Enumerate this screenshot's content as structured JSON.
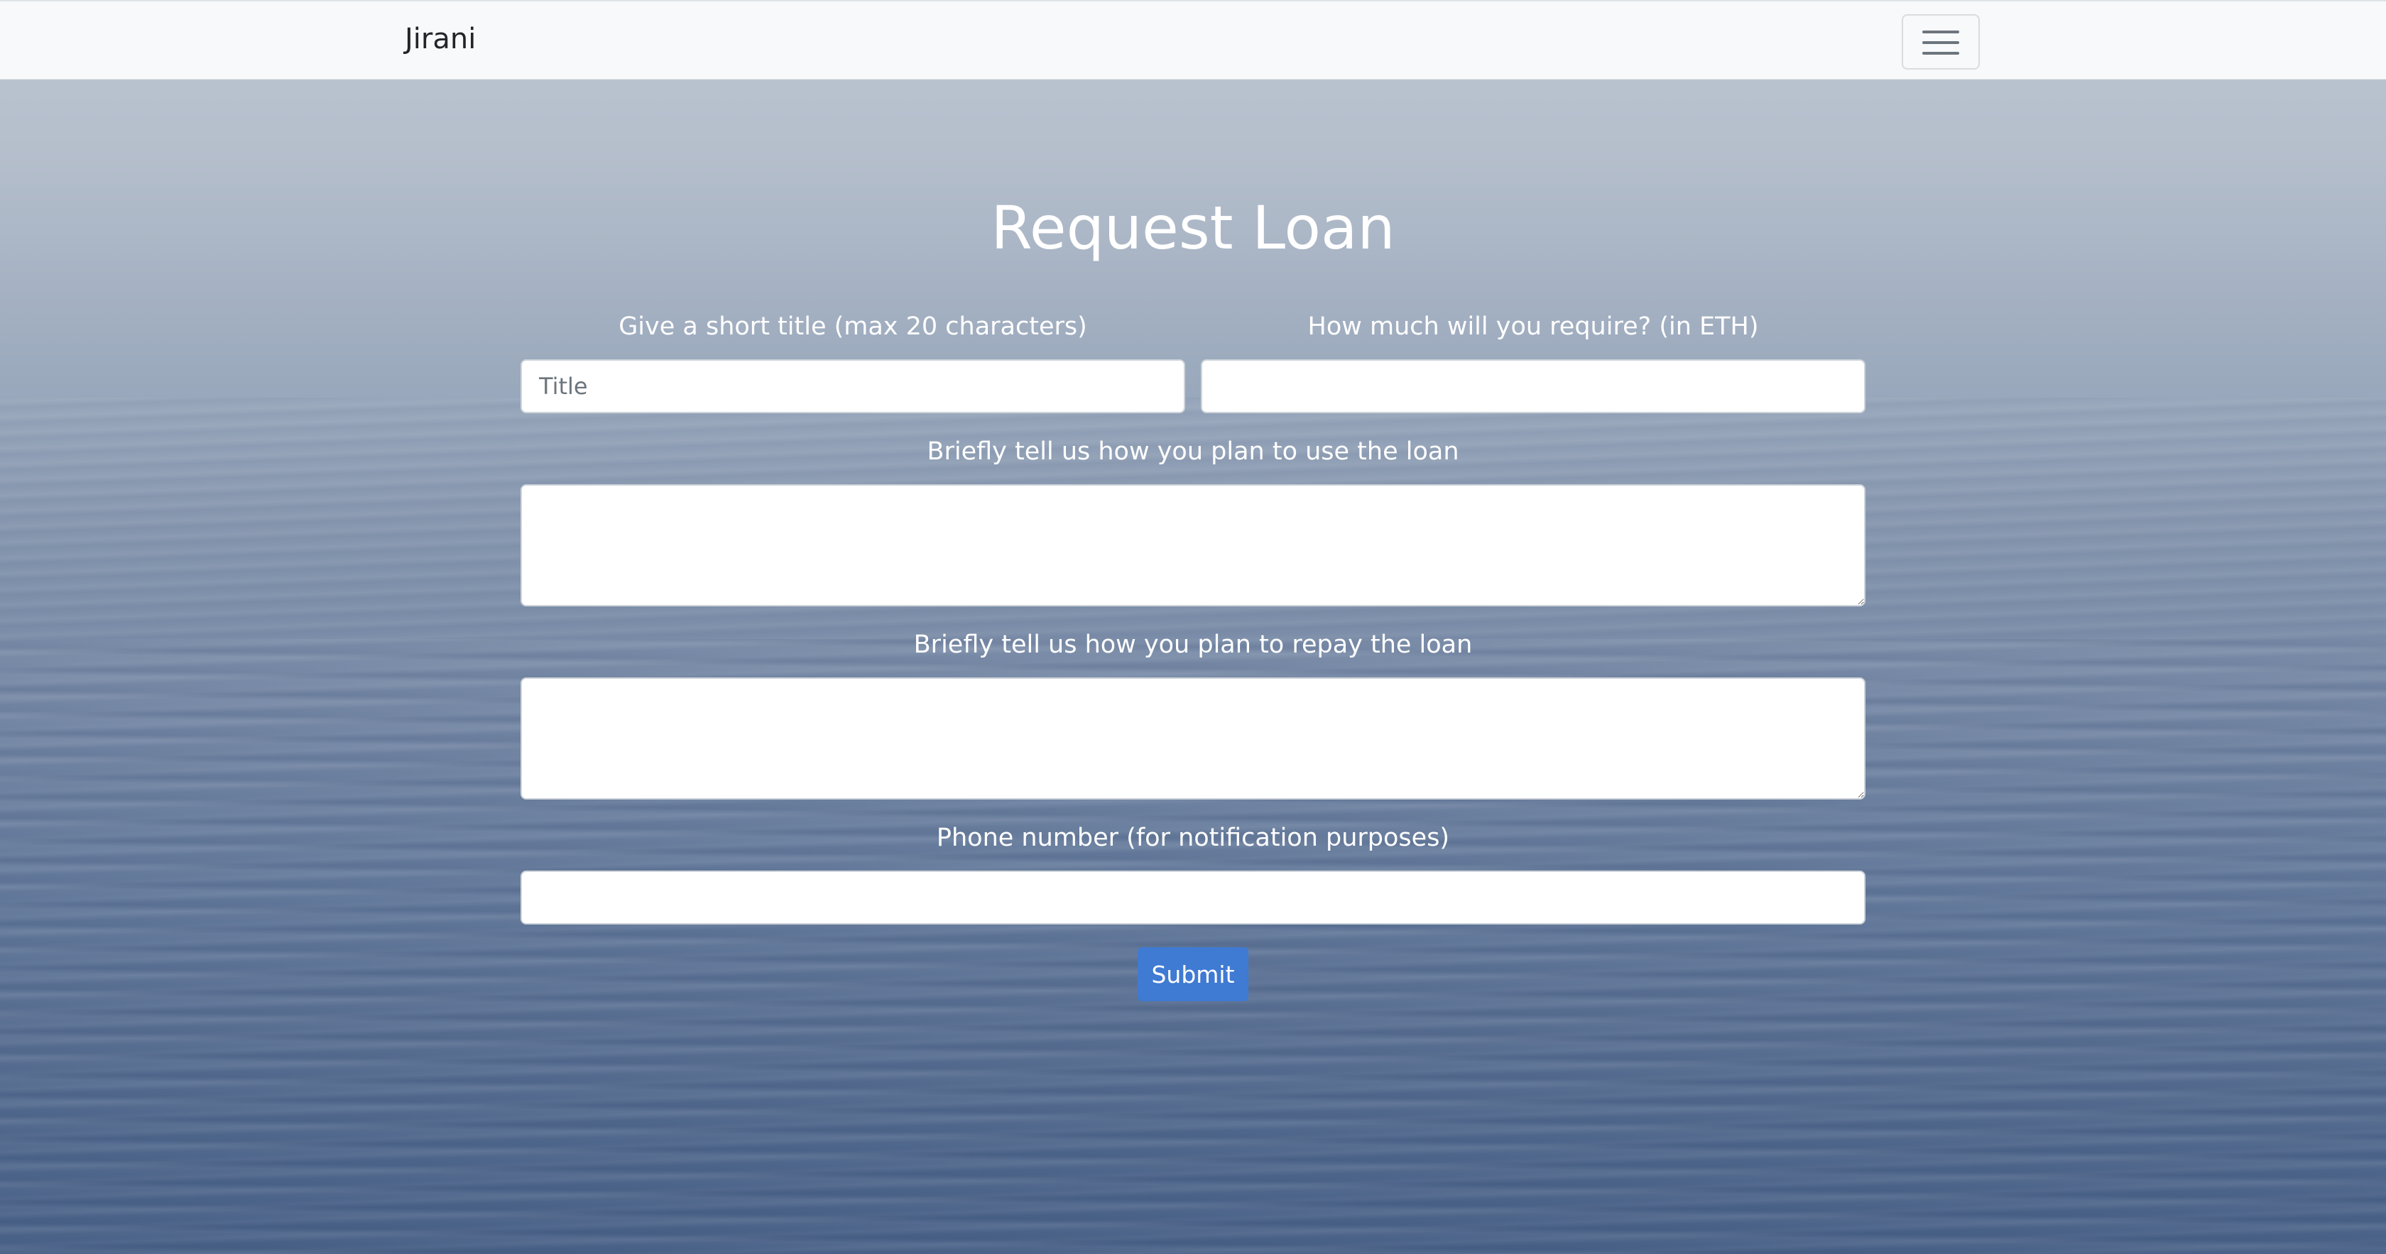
{
  "navbar": {
    "brand": "Jirani",
    "toggler_icon": "hamburger-menu-icon"
  },
  "form": {
    "heading": "Request Loan",
    "title_label": "Give a short title (max 20 characters)",
    "title_placeholder": "Title",
    "title_value": "",
    "amount_label": "How much will you require? (in ETH)",
    "amount_value": "",
    "use_label": "Briefly tell us how you plan to use the loan",
    "use_value": "",
    "repay_label": "Briefly tell us how you plan to repay the loan",
    "repay_value": "",
    "phone_label": "Phone number (for notification purposes)",
    "phone_value": "",
    "submit_label": "Submit"
  },
  "colors": {
    "navbar_bg": "#f8f9fa",
    "submit_bg": "#3f7ad3",
    "text_on_bg": "#ffffff"
  }
}
